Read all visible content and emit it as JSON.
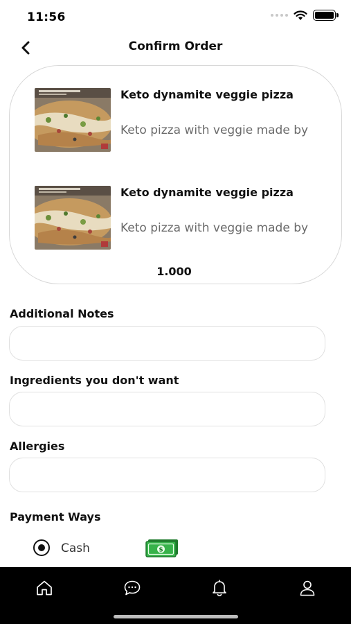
{
  "status_bar": {
    "time": "11:56"
  },
  "header": {
    "title": "Confirm Order",
    "back_icon": "chevron-left-icon"
  },
  "order": {
    "items": [
      {
        "name": "Keto dynamite veggie pizza",
        "description": "Keto pizza with veggie made by"
      },
      {
        "name": "Keto dynamite veggie pizza",
        "description": "Keto pizza with veggie made by"
      }
    ],
    "total": "1.000"
  },
  "form": {
    "additional_notes": {
      "label": "Additional Notes",
      "value": "",
      "placeholder": ""
    },
    "ingredients_unwanted": {
      "label": "Ingredients you don't want",
      "value": "",
      "placeholder": ""
    },
    "allergies": {
      "label": "Allergies",
      "value": "",
      "placeholder": ""
    }
  },
  "payment": {
    "label": "Payment Ways",
    "options": [
      {
        "label": "Cash",
        "selected": true,
        "icon": "cash-icon"
      }
    ]
  },
  "tab_bar": {
    "tabs": [
      {
        "icon": "home-icon"
      },
      {
        "icon": "chat-icon"
      },
      {
        "icon": "bell-icon"
      },
      {
        "icon": "user-icon"
      }
    ]
  },
  "colors": {
    "tab_bar_bg": "#000000",
    "cash_green": "#2e9e3a",
    "card_border": "#d8d8d8"
  }
}
